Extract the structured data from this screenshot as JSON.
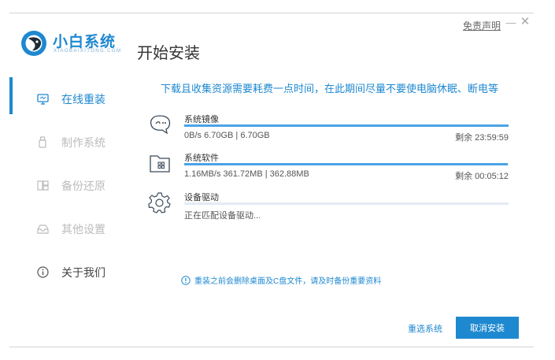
{
  "window": {
    "disclaimer_label": "免责声明",
    "minimize_glyph": "—",
    "close_glyph": "✕"
  },
  "logo": {
    "name": "小白系统",
    "url": "XIAOBAIXITONG.COM"
  },
  "page_title": "开始安装",
  "sidebar": {
    "items": [
      {
        "label": "在线重装",
        "icon": "monitor-icon",
        "state": "active"
      },
      {
        "label": "制作系统",
        "icon": "usb-drive-icon",
        "state": "inactive"
      },
      {
        "label": "备份还原",
        "icon": "backup-icon",
        "state": "inactive"
      },
      {
        "label": "其他设置",
        "icon": "tray-icon",
        "state": "inactive"
      },
      {
        "label": "关于我们",
        "icon": "info-icon",
        "state": "normal"
      }
    ]
  },
  "notice": "下载且收集资源需要耗费一点时间，在此期间尽量不要使电脑休眠、断电等",
  "tasks": [
    {
      "name": "系统镜像",
      "detail": "0B/s 6.70GB | 6.70GB",
      "remaining": "剩余 23:59:59",
      "icon": "chat-bubble-icon",
      "progress": 1.0
    },
    {
      "name": "系统软件",
      "detail": "1.16MB/s 361.72MB | 362.88MB",
      "remaining": "剩余 00:05:12",
      "icon": "folder-icon",
      "progress": 0.997
    },
    {
      "name": "设备驱动",
      "detail": "正在匹配设备驱动...",
      "remaining": "",
      "icon": "gear-icon",
      "progress": 0.0
    }
  ],
  "warning": "重装之前会删除桌面及C盘文件，请及时备份重要资料",
  "actions": {
    "reselect_label": "重选系统",
    "cancel_label": "取消安装"
  },
  "colors": {
    "accent": "#1e88d0",
    "progress_fill": "#4aa3e6",
    "progress_track": "#e3ebf3"
  }
}
